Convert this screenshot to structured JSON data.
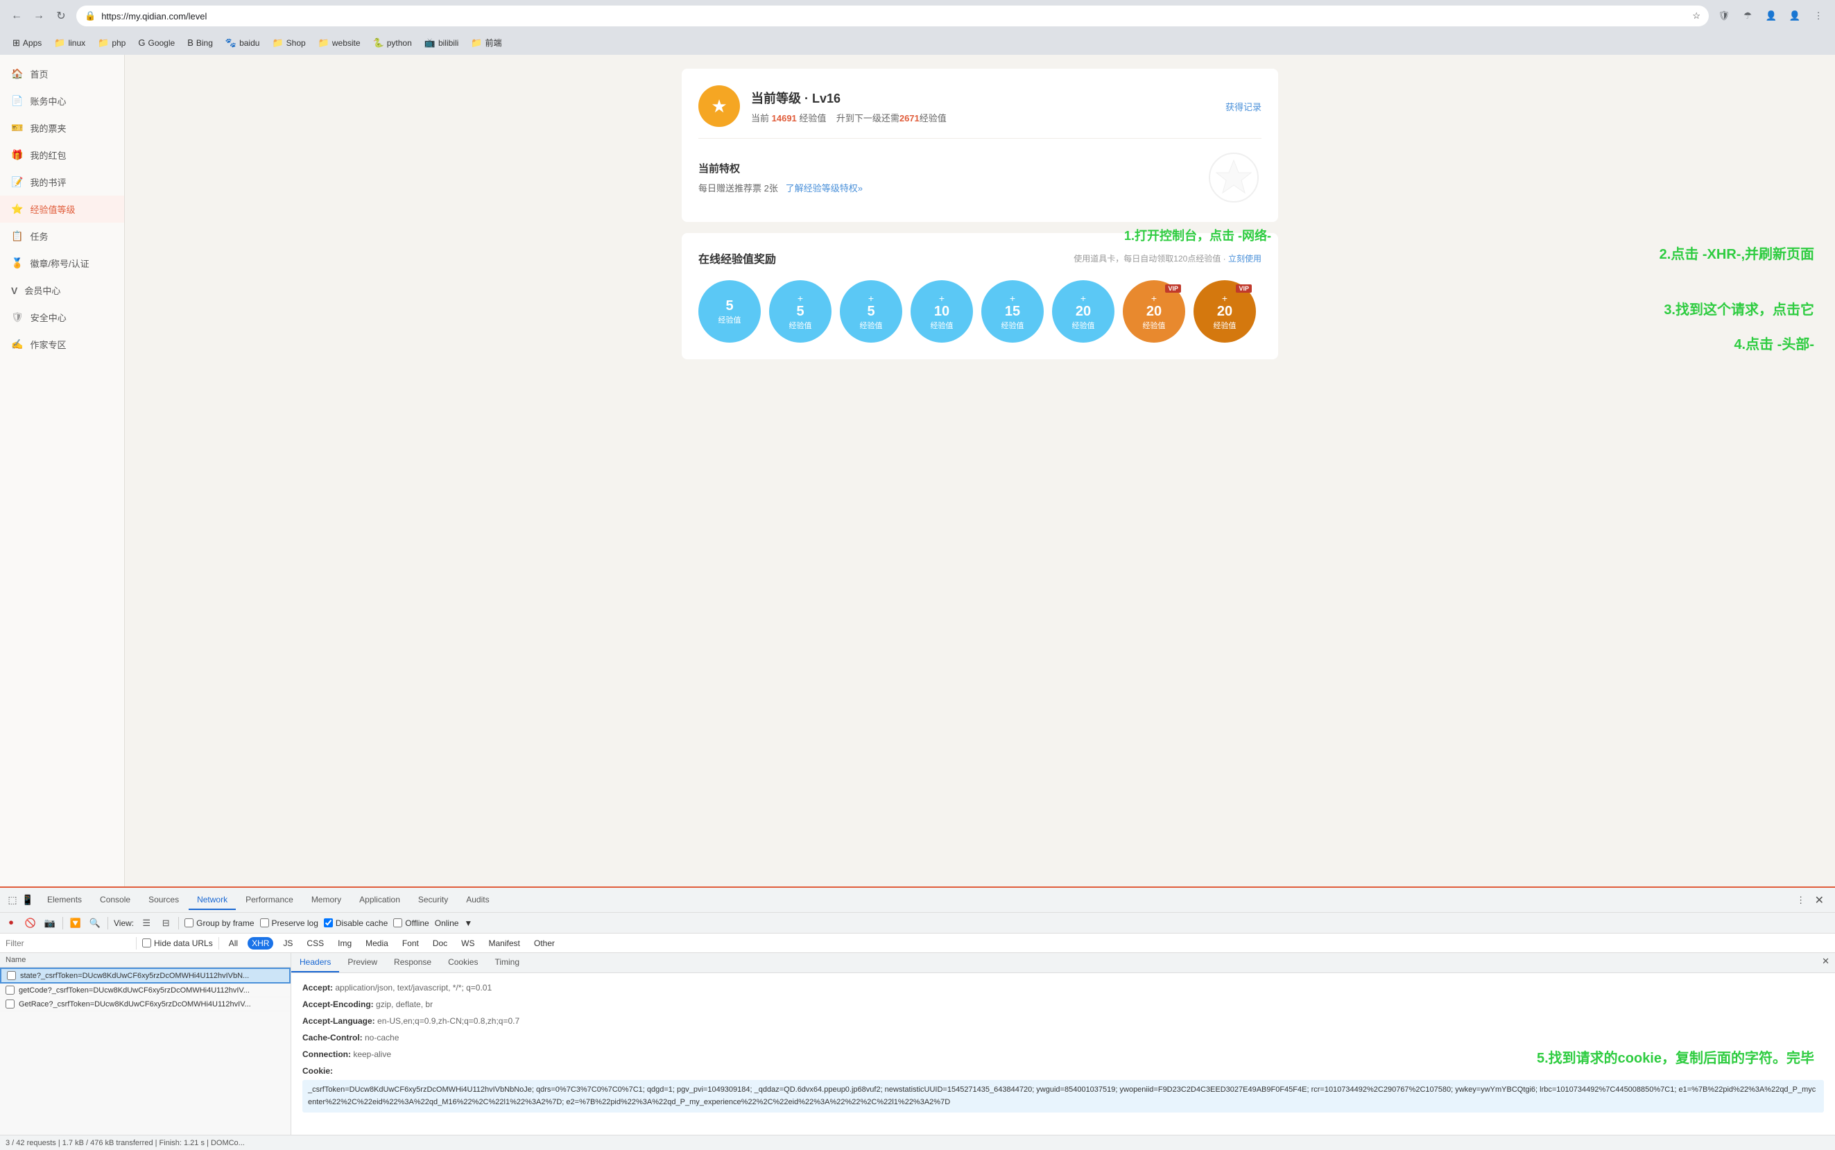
{
  "browser": {
    "url": "https://my.qidian.com/level",
    "bookmarks": [
      {
        "icon": "⊞",
        "label": "Apps"
      },
      {
        "icon": "📁",
        "label": "linux"
      },
      {
        "icon": "📁",
        "label": "php"
      },
      {
        "icon": "G",
        "label": "Google"
      },
      {
        "icon": "B",
        "label": "Bing"
      },
      {
        "icon": "🐾",
        "label": "baidu"
      },
      {
        "icon": "📁",
        "label": "Shop"
      },
      {
        "icon": "📁",
        "label": "website"
      },
      {
        "icon": "🐍",
        "label": "python"
      },
      {
        "icon": "📺",
        "label": "bilibili"
      },
      {
        "icon": "📁",
        "label": "前端"
      }
    ]
  },
  "sidebar": {
    "items": [
      {
        "icon": "🏠",
        "label": "首页",
        "active": false
      },
      {
        "icon": "📄",
        "label": "账务中心",
        "active": false
      },
      {
        "icon": "🎫",
        "label": "我的票夹",
        "active": false
      },
      {
        "icon": "🎁",
        "label": "我的红包",
        "active": false
      },
      {
        "icon": "📝",
        "label": "我的书评",
        "active": false
      },
      {
        "icon": "⭐",
        "label": "经验值等级",
        "active": true
      },
      {
        "icon": "📋",
        "label": "任务",
        "active": false
      },
      {
        "icon": "🏅",
        "label": "徽章/称号/认证",
        "active": false
      },
      {
        "icon": "V",
        "label": "会员中心",
        "active": false
      },
      {
        "icon": "🛡",
        "label": "安全中心",
        "active": false
      },
      {
        "icon": "✍",
        "label": "作家专区",
        "active": false
      }
    ]
  },
  "level": {
    "badge": "⭐",
    "title": "当前等级 · Lv16",
    "current_exp": "14691",
    "exp_label": "经验值",
    "next_label": "升到下一级还需",
    "next_exp": "2671",
    "next_exp_unit": "经验值",
    "history_link": "获得记录",
    "privilege_title": "当前特权",
    "privilege_desc": "每日赠送推荐票 2张",
    "privilege_link": "了解经验等级特权»"
  },
  "rewards": {
    "title": "在线经验值奖励",
    "desc": "使用道具卡，每日自动领取120点经验值 · ",
    "link": "立刻使用",
    "circles": [
      {
        "value": "5",
        "label": "经验值",
        "type": "cyan"
      },
      {
        "value": "+5",
        "label": "经验值",
        "type": "cyan"
      },
      {
        "value": "+5",
        "label": "经验值",
        "type": "cyan"
      },
      {
        "value": "+10",
        "label": "经验值",
        "type": "cyan"
      },
      {
        "value": "+15",
        "label": "经验值",
        "type": "cyan"
      },
      {
        "value": "+20",
        "label": "经验值",
        "type": "cyan"
      },
      {
        "value": "+20",
        "label": "经验值",
        "type": "orange_vip",
        "vip": true
      },
      {
        "value": "+20",
        "label": "经验值",
        "type": "orange_vip2",
        "vip": true
      }
    ]
  },
  "annotations": {
    "step1": "1.打开控制台，点击 -网络-",
    "step2": "2.点击 -XHR-,并刷新页面",
    "step3": "3.找到这个请求，点击它",
    "step4": "4.点击 -头部-",
    "step5": "5.找到请求的cookie，复制后面的字符。完毕"
  },
  "devtools": {
    "tabs": [
      "Elements",
      "Console",
      "Sources",
      "Network",
      "Performance",
      "Memory",
      "Application",
      "Security",
      "Audits"
    ],
    "active_tab": "Network",
    "toolbar": {
      "view_label": "View:",
      "group_by_frame": "Group by frame",
      "preserve_log": "Preserve log",
      "disable_cache": "Disable cache",
      "offline": "Offline",
      "online": "Online"
    },
    "filter": {
      "placeholder": "Filter",
      "hide_data": "Hide data URLs",
      "types": [
        "All",
        "XHR",
        "JS",
        "CSS",
        "Img",
        "Media",
        "Font",
        "Doc",
        "WS",
        "Manifest",
        "Other"
      ],
      "active_type": "XHR"
    },
    "columns": [
      "Name"
    ],
    "requests": [
      {
        "name": "state?_csrfToken=DUcw8KdUwCF6xy5rzDcOMWHi4U112hvIVbN...",
        "selected": true
      },
      {
        "name": "getCode?_csrfToken=DUcw8KdUwCF6xy5rzDcOMWHi4U112hvIV...",
        "selected": false
      },
      {
        "name": "GetRace?_csrfToken=DUcw8KdUwCF6xy5rzDcOMWHi4U112hvIV...",
        "selected": false
      }
    ],
    "details": {
      "tabs": [
        "Headers",
        "Preview",
        "Response",
        "Cookies",
        "Timing"
      ],
      "active_tab": "Headers",
      "headers": [
        {
          "key": "Accept:",
          "value": "application/json, text/javascript, */*; q=0.01"
        },
        {
          "key": "Accept-Encoding:",
          "value": "gzip, deflate, br"
        },
        {
          "key": "Accept-Language:",
          "value": "en-US,en;q=0.9,zh-CN;q=0.8,zh;q=0.7"
        },
        {
          "key": "Cache-Control:",
          "value": "no-cache"
        },
        {
          "key": "Connection:",
          "value": "keep-alive"
        },
        {
          "key": "Cookie:",
          "value": "_csrfToken=DUcw8KdUwCF6xy5rzDcOMWHi4U112hvIVbNbNoJe; qdrs=0%7C3%7C0%7C0%7C1; qdgd=1; pgv_pvi=1049309184; _qddaz=QD.6dvx64.ppeup0.jp68vuf2; newstatisticUUID=1545271435_643844720; ywguid=854001037519; ywopeniid=F9D23C2D4C3EED3027E49AB9F0F45F4E; rcr=1010734492%2C290767%2C107580; ywkey=ywYmYBCQtgi6; lrbc=1010734492%7C445008850%7C1; e1=%7B%22pid%22%3A%22qd_P_mycenter%22%2C%22eid%22%3A%22qd_M16%22%2C%22l1%22%3A2%7D; e2=%7B%22pid%22%3A%22qd_P_my_experience%22%2C%22eid%22%3A%22%22%2C%22l1%22%3A2%7D"
        }
      ]
    },
    "status_bar": "3 / 42 requests | 1.7 kB / 476 kB transferred | Finish: 1.21 s | DOMCo..."
  }
}
